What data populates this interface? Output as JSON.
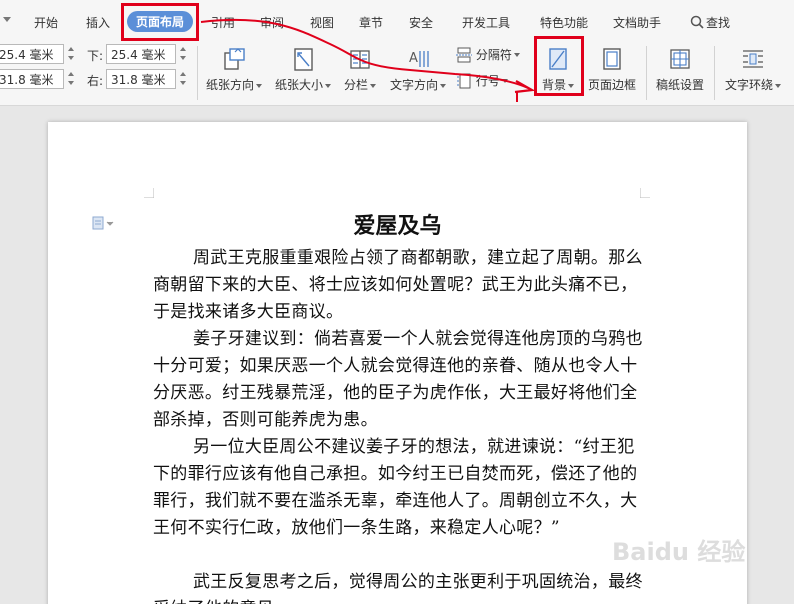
{
  "tabs": [
    {
      "label": "开始"
    },
    {
      "label": "插入"
    },
    {
      "label": "页面布局"
    },
    {
      "label": "引用"
    },
    {
      "label": "审阅"
    },
    {
      "label": "视图"
    },
    {
      "label": "章节"
    },
    {
      "label": "安全"
    },
    {
      "label": "开发工具"
    },
    {
      "label": "特色功能"
    },
    {
      "label": "文档助手"
    },
    {
      "label": "查找"
    }
  ],
  "margins": {
    "top_value": "25.4 毫米",
    "left_value": "31.8 毫米",
    "bottom_label": "下:",
    "bottom_value": "25.4 毫米",
    "right_label": "右:",
    "right_value": "31.8 毫米"
  },
  "ribbon": {
    "orientation": "纸张方向",
    "size": "纸张大小",
    "columns": "分栏",
    "text_direction": "文字方向",
    "breaks": "分隔符",
    "line_numbers": "行号",
    "background": "背景",
    "page_border": "页面边框",
    "manuscript": "稿纸设置",
    "text_wrap": "文字环绕"
  },
  "document": {
    "title": "爱屋及乌",
    "paragraphs": [
      "周武王克服重重艰险占领了商都朝歌，建立起了周朝。那么商朝留下来的大臣、将士应该如何处置呢？武王为此头痛不已，于是找来诸多大臣商议。",
      "姜子牙建议到：倘若喜爱一个人就会觉得连他房顶的乌鸦也十分可爱；如果厌恶一个人就会觉得连他的亲眷、随从也令人十分厌恶。纣王残暴荒淫，他的臣子为虎作伥，大王最好将他们全部杀掉，否则可能养虎为患。",
      "另一位大臣周公不建议姜子牙的想法，就进谏说：“纣王犯下的罪行应该有他自己承担。如今纣王已自焚而死，偿还了他的罪行，我们就不要在滥杀无辜，牵连他人了。周朝创立不久，大王何不实行仁政，放他们一条生路，来稳定人心呢？”",
      "武王反复思考之后，觉得周公的主张更利于巩固统治，最终采纳了他的意见。"
    ]
  },
  "watermark": "Baidu 经验",
  "colors": {
    "annotation_red": "#e0001b",
    "active_tab_blue": "#5b8fd8"
  }
}
